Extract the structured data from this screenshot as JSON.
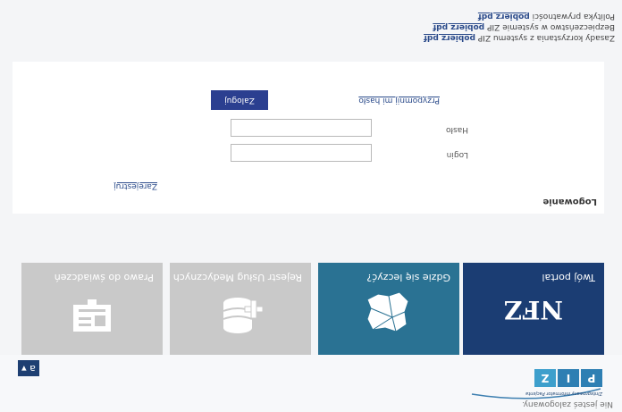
{
  "header": {
    "status_text": "Nie jesteś zalogowany.",
    "logo": {
      "letters": [
        "P",
        "I",
        "Z"
      ],
      "caption": "Zintegrowany Informator Pacjenta"
    },
    "accessibility_button": "a ▾"
  },
  "tiles": [
    {
      "label": "Twój portal",
      "logo_text": "NFZ",
      "color": "#1b3d73"
    },
    {
      "label": "Gdzie się leczyć?",
      "icon": "map-icon",
      "color": "#2a7293"
    },
    {
      "label": "Rejestr Usług Medycznych",
      "icon": "database-plus-icon",
      "color": "#c9c9c9"
    },
    {
      "label": "Prawo do świadczeń",
      "icon": "card-icon",
      "color": "#c9c9c9"
    }
  ],
  "login": {
    "heading": "Logowanie",
    "register_label": "Zarejestruj",
    "login_label": "Login",
    "password_label": "Hasło",
    "forgot_label": "Przypomnij mi hasło",
    "submit_label": "Zaloguj"
  },
  "footer": {
    "line1_text": "Zasady korzystania z systemu ZIP",
    "line1_link": "pobierz pdf",
    "line2_text": "Bezpieczeństwo w systemie ZIP",
    "line2_link": "pobierz pdf",
    "line3_text": "Polityka prywatności",
    "line3_link": "pobierz pdf"
  }
}
